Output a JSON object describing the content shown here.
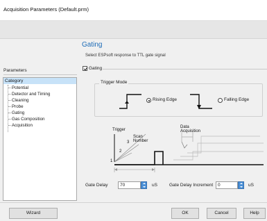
{
  "window": {
    "title": "Acquisition Parameters (Default.prm)"
  },
  "header": {
    "title": "Gating",
    "subtitle": "Select ESPsoft response to TTL gate signal"
  },
  "sidebar": {
    "label": "Parameters",
    "category": "Category",
    "items": [
      "Potential",
      "Detector and Timing",
      "Cleaning",
      "Probe",
      "Gating",
      "Gas Composition",
      "Acquisition"
    ]
  },
  "gating": {
    "enable_label": "Gating",
    "enabled": true,
    "trigger_mode": {
      "label": "Trigger Mode",
      "rising_label": "Rising Edge",
      "falling_label": "Falling Edge",
      "selected": "rising"
    }
  },
  "diagram": {
    "trigger_label": "Trigger",
    "scan_number_label": "Scan Number",
    "data_acquisition_label": "Data Acquisition",
    "num_1": "1",
    "num_2": "2",
    "num_3": "3"
  },
  "fields": {
    "gate_delay_label": "Gate Delay",
    "gate_delay_value": "70",
    "gate_delay_unit": "uS",
    "gate_delay_increment_label": "Gate Delay Increment",
    "gate_delay_increment_value": "0",
    "gate_delay_increment_unit": "uS"
  },
  "buttons": {
    "wizard": "Wizard",
    "ok": "OK",
    "cancel": "Cancel",
    "help": "Help"
  },
  "colors": {
    "accent_title": "#1c6bb7",
    "tree_selection": "#c7e2f8",
    "spin_button": "#4a8fd6"
  }
}
